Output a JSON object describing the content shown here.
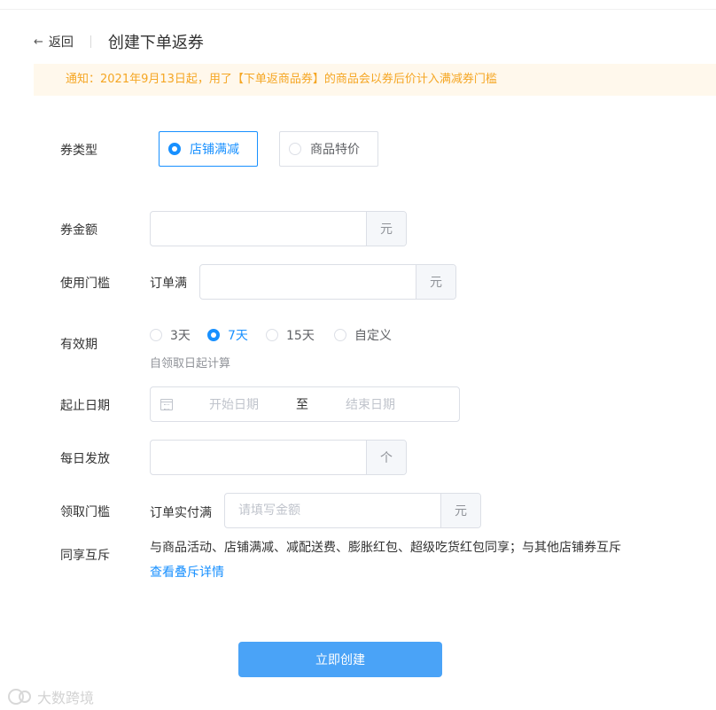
{
  "header": {
    "back_label": "返回",
    "title": "创建下单返券"
  },
  "notice": {
    "text": "通知：2021年9月13日起，用了【下单返商品券】的商品会以券后价计入满减券门槛"
  },
  "coupon_type": {
    "label": "券类型",
    "options": [
      {
        "label": "店铺满减",
        "selected": true
      },
      {
        "label": "商品特价",
        "selected": false
      }
    ]
  },
  "coupon_amount": {
    "label": "券金额",
    "value": "",
    "placeholder": "",
    "suffix": "元"
  },
  "threshold": {
    "label": "使用门槛",
    "prefix": "订单满",
    "value": "",
    "placeholder": "",
    "suffix": "元"
  },
  "validity": {
    "label": "有效期",
    "options": [
      {
        "label": "3天",
        "selected": false
      },
      {
        "label": "7天",
        "selected": true
      },
      {
        "label": "15天",
        "selected": false
      },
      {
        "label": "自定义",
        "selected": false
      }
    ],
    "hint": "自领取日起计算"
  },
  "date_range": {
    "label": "起止日期",
    "start_placeholder": "开始日期",
    "separator": "至",
    "end_placeholder": "结束日期"
  },
  "daily_issue": {
    "label": "每日发放",
    "value": "",
    "placeholder": "",
    "suffix": "个"
  },
  "claim_threshold": {
    "label": "领取门槛",
    "prefix": "订单实付满",
    "value": "",
    "placeholder": "请填写金额",
    "suffix": "元"
  },
  "sharing": {
    "label": "同享互斥",
    "text": "与商品活动、店铺满减、减配送费、膨胀红包、超级吃货红包同享；与其他店铺券互斥",
    "link": "查看叠斥详情"
  },
  "submit": {
    "label": "立即创建"
  },
  "watermark": {
    "text": "大数跨境"
  },
  "colors": {
    "primary": "#1890ff",
    "button": "#4aa3f7",
    "notice_bg": "#fff8ec",
    "notice_text": "#f5a623",
    "border": "#dcdfe6"
  }
}
